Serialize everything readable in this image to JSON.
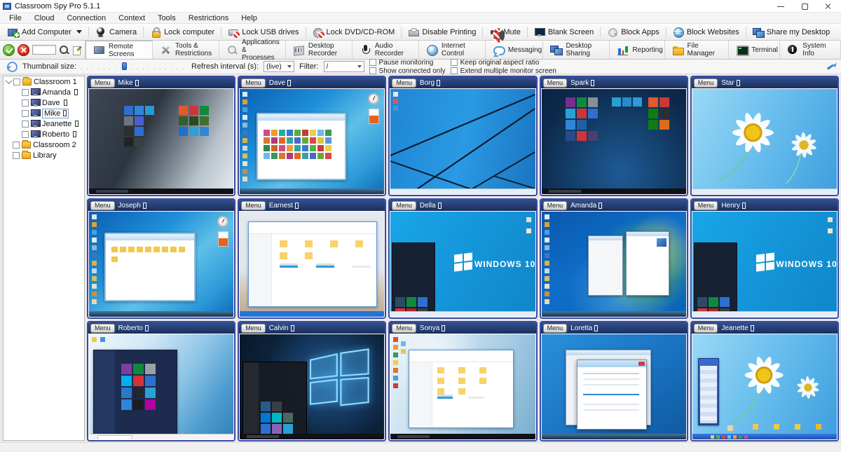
{
  "window": {
    "title": "Classroom Spy Pro 5.1.1"
  },
  "menu_bar": [
    "File",
    "Cloud",
    "Connection",
    "Context",
    "Tools",
    "Restrictions",
    "Help"
  ],
  "toolbar": [
    {
      "label": "Add Computer"
    },
    {
      "label": "Camera"
    },
    {
      "label": "Lock computer"
    },
    {
      "label": "Lock USB drives"
    },
    {
      "label": "Lock DVD/CD-ROM"
    },
    {
      "label": "Disable Printing"
    },
    {
      "label": "Mute"
    },
    {
      "label": "Blank Screen"
    },
    {
      "label": "Block Apps"
    },
    {
      "label": "Block Websites"
    },
    {
      "label": "Share my Desktop"
    }
  ],
  "search": {
    "value": ""
  },
  "tabs": [
    {
      "label": "Remote Screens",
      "active": true
    },
    {
      "label": "Tools & Restrictions",
      "active": false
    },
    {
      "label": "Applications & Processes",
      "active": false
    },
    {
      "label": "Desktop Recorder",
      "active": false
    },
    {
      "label": "Audio Recorder",
      "active": false
    },
    {
      "label": "Internet Control",
      "active": false
    },
    {
      "label": "Messaging",
      "active": false
    },
    {
      "label": "Desktop Sharing",
      "active": false
    },
    {
      "label": "Reporting",
      "active": false
    },
    {
      "label": "File Manager",
      "active": false
    },
    {
      "label": "Terminal",
      "active": false
    },
    {
      "label": "System Info",
      "active": false
    }
  ],
  "options": {
    "thumbnail_size_label": "Thumbnail size:",
    "refresh_label": "Refresh interval (s):",
    "refresh_value": "(live)",
    "filter_label": "Filter:",
    "filter_value": "/",
    "checkboxes": [
      "Pause monitoring",
      "Show connected only",
      "Keep original aspect ratio",
      "Extend multiple monitor screen"
    ]
  },
  "sidebar": {
    "status_suffix": "▯",
    "selected": "Mike",
    "groups": [
      {
        "label": "Classroom 1",
        "computers": [
          "Amanda",
          "Dave",
          "Mike",
          "Jeanette",
          "Roberto"
        ]
      },
      {
        "label": "Classroom 2",
        "computers": []
      },
      {
        "label": "Library",
        "computers": []
      }
    ]
  },
  "grid": {
    "menu_label": "Menu",
    "status_suffix": "▯",
    "tiles": [
      {
        "name": "Mike"
      },
      {
        "name": "Dave"
      },
      {
        "name": "Borg"
      },
      {
        "name": "Spark"
      },
      {
        "name": "Star"
      },
      {
        "name": "Joseph"
      },
      {
        "name": "Earnest"
      },
      {
        "name": "Della",
        "screen_text": "WINDOWS 10"
      },
      {
        "name": "Amanda"
      },
      {
        "name": "Henry",
        "screen_text": "WINDOWS 10"
      },
      {
        "name": "Roberto"
      },
      {
        "name": "Calvin"
      },
      {
        "name": "Sonya"
      },
      {
        "name": "Loretta"
      },
      {
        "name": "Jeanette"
      }
    ]
  }
}
